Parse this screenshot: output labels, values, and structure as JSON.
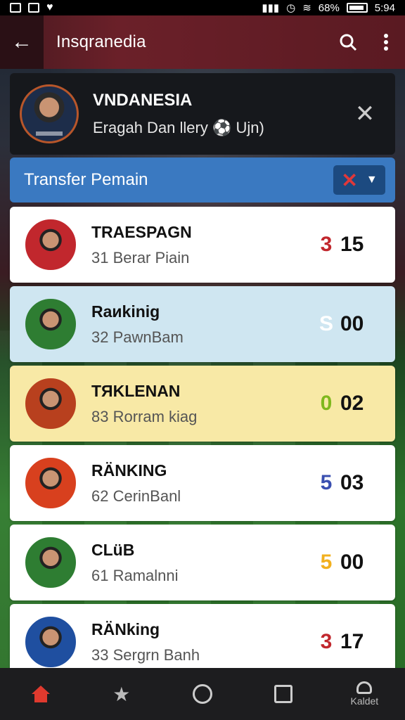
{
  "status_bar": {
    "battery": "68%",
    "time": "5:94"
  },
  "app_bar": {
    "back_icon": "arrow-left-icon",
    "title": "Insqranedia",
    "search_icon": "search-icon",
    "more_icon": "more-vertical-icon"
  },
  "profile": {
    "name": "VNDANESIA",
    "subtitle": "Eragah Dan llery ⚽ Ujn)",
    "close_icon": "close-icon"
  },
  "section": {
    "title": "Transfer Pemain",
    "filter_icon": "x-icon",
    "dropdown_icon": "chevron-down-icon"
  },
  "rows": [
    {
      "name": "TRAESPAGN",
      "sub": "31  Berar Piain",
      "mark": "3",
      "number": "15",
      "bg": "#ffffff",
      "badge": "#c1272d",
      "mark_color": "#c1272d"
    },
    {
      "name": "Raиkinig",
      "sub": "32  PawnBam",
      "mark": "S",
      "number": "00",
      "bg": "#cfe6f1",
      "badge": "#2e7d32",
      "mark_color": "#ffffff"
    },
    {
      "name": "TЯKLENAN",
      "sub": "83  Rorram kiag",
      "mark": "0",
      "number": "02",
      "bg": "#f8e9a6",
      "badge": "#b8401e",
      "mark_color": "#7fb81e"
    },
    {
      "name": "RÄNKING",
      "sub": "62  CerinBanl",
      "mark": "5",
      "number": "03",
      "bg": "#ffffff",
      "badge": "#d8401e",
      "mark_color": "#3a4fb0"
    },
    {
      "name": "CLüB",
      "sub": "61  Ramalnni",
      "mark": "5",
      "number": "00",
      "bg": "#ffffff",
      "badge": "#2e7d32",
      "mark_color": "#f2b01e"
    },
    {
      "name": "RÄNking",
      "sub": "33  Sergrn Banh",
      "mark": "3",
      "number": "17",
      "bg": "#ffffff",
      "badge": "#1f4fa0",
      "mark_color": "#c1272d"
    }
  ],
  "bottom_nav": {
    "home_icon": "home-icon",
    "star_icon": "star-icon",
    "circle_icon": "circle-icon",
    "square_icon": "square-icon",
    "profile_icon": "user-icon",
    "profile_label": "Kaldet"
  },
  "colors": {
    "appbar": "#6b2029",
    "section": "#3a79c1",
    "active_nav": "#e03a2e"
  }
}
